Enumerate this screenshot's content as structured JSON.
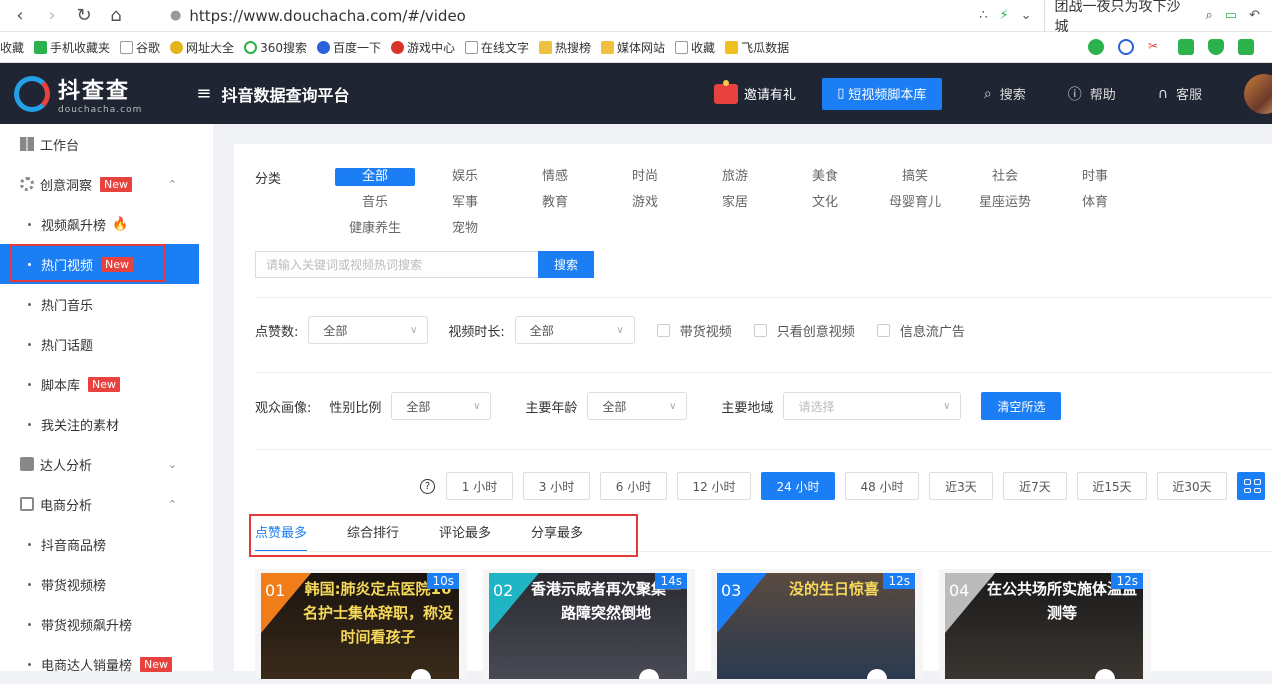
{
  "browser": {
    "url": "https://www.douchacha.com/#/video",
    "tab_title": "团战一夜只为攻下沙城"
  },
  "bookmarks": [
    "收藏",
    "手机收藏夹",
    "谷歌",
    "网址大全",
    "360搜索",
    "百度一下",
    "游戏中心",
    "在线文字",
    "热搜榜",
    "媒体网站",
    "收藏",
    "飞瓜数据"
  ],
  "app": {
    "logo_name": "抖查查",
    "logo_domain": "douchacha.com",
    "platform_title": "抖音数据查询平台",
    "invite": "邀请有礼",
    "script_library": "短视频脚本库",
    "search": "搜索",
    "help": "帮助",
    "service": "客服"
  },
  "sidebar": {
    "workbench": "工作台",
    "creative": "创意洞察",
    "new_badge": "New",
    "video_rising": "视频飙升榜",
    "hot_videos": "热门视频",
    "hot_music": "热门音乐",
    "hot_topics": "热门话题",
    "script_lib": "脚本库",
    "my_follows": "我关注的素材",
    "influencer": "达人分析",
    "ecommerce": "电商分析",
    "product_rank": "抖音商品榜",
    "goods_video_rank": "带货视频榜",
    "goods_video_rising": "带货视频飙升榜",
    "ecom_sales_rank": "电商达人销量榜"
  },
  "filters": {
    "category_label": "分类",
    "categories": [
      "全部",
      "娱乐",
      "情感",
      "时尚",
      "旅游",
      "美食",
      "搞笑",
      "社会",
      "时事",
      "音乐",
      "军事",
      "教育",
      "游戏",
      "家居",
      "文化",
      "母婴育儿",
      "星座运势",
      "体育",
      "健康养生",
      "宠物"
    ],
    "search_placeholder": "请输入关键词或视频热词搜索",
    "search_button": "搜索",
    "likes_label": "点赞数:",
    "likes_value": "全部",
    "duration_label": "视频时长:",
    "duration_value": "全部",
    "goods_video": "带货视频",
    "creative_only": "只看创意视频",
    "feed_ads": "信息流广告",
    "audience_label": "观众画像:",
    "gender_label": "性别比例",
    "gender_value": "全部",
    "age_label": "主要年龄",
    "age_value": "全部",
    "region_label": "主要地域",
    "region_placeholder": "请选择",
    "clear_all": "清空所选"
  },
  "time_ranges": [
    "1 小时",
    "3 小时",
    "6 小时",
    "12 小时",
    "24 小时",
    "48 小时",
    "近3天",
    "近7天",
    "近15天",
    "近30天"
  ],
  "selected_time_index": 4,
  "sort_tabs": [
    "点赞最多",
    "综合排行",
    "评论最多",
    "分享最多"
  ],
  "videos": [
    {
      "rank": "01",
      "duration": "10s",
      "caption": "韩国:肺炎定点医院16名护士集体辞职，称没时间看孩子",
      "color": "#f07d1a"
    },
    {
      "rank": "02",
      "duration": "14s",
      "caption": "香港示威者再次聚集一路障突然倒地",
      "color": "#1fb5c5"
    },
    {
      "rank": "03",
      "duration": "12s",
      "caption": "没的生日惊喜",
      "color": "#1b7ef5"
    },
    {
      "rank": "04",
      "duration": "12s",
      "caption": "在公共场所实施体温监测等",
      "color": "#bbbbbb"
    }
  ]
}
